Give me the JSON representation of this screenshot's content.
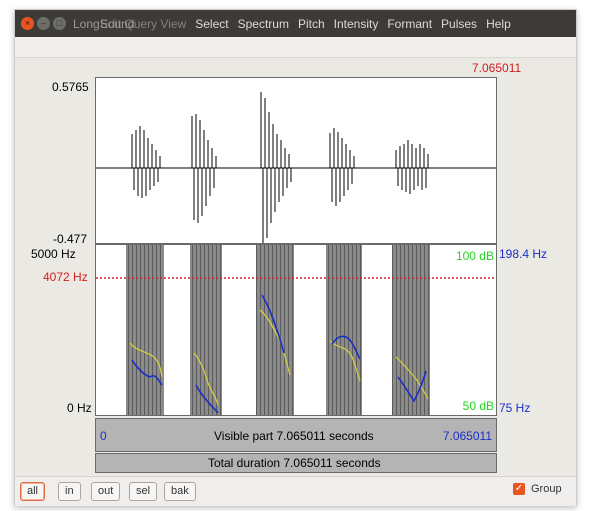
{
  "window": {
    "title": "LongSound",
    "title_overlap_ghost": "Edit Query View",
    "menus": [
      "Select",
      "Spectrum",
      "Pitch",
      "Intensity",
      "Formant",
      "Pulses",
      "Help"
    ],
    "controls": {
      "close": "×",
      "minimize": "–",
      "maximize": "□"
    }
  },
  "waveform": {
    "max_label": "0.5765",
    "min_label": "-0.477",
    "end_time_label": "7.065011"
  },
  "spectrogram": {
    "freq_top_label": "5000 Hz",
    "freq_bottom_label": "0 Hz",
    "cursor_freq_label": "4072 Hz",
    "intensity_top_label": "100 dB",
    "intensity_bottom_label": "50 dB",
    "pitch_top_label": "198.4 Hz",
    "pitch_bottom_label": "75 Hz"
  },
  "timeline": {
    "left_time": "0",
    "visible_text": "Visible part 7.065011 seconds",
    "right_time": "7.065011",
    "total_text": "Total duration 7.065011 seconds"
  },
  "toolbar": {
    "buttons": [
      "all",
      "in",
      "out",
      "sel",
      "bak"
    ],
    "group_label": "Group",
    "group_checked": true
  },
  "colors": {
    "accent": "#e95420",
    "cursor_red": "#d22020",
    "intensity_green": "#21d41f",
    "pitch_blue": "#1a2fc7",
    "formant_yellow": "#d8d33a"
  },
  "icons": {
    "check": "✓"
  }
}
